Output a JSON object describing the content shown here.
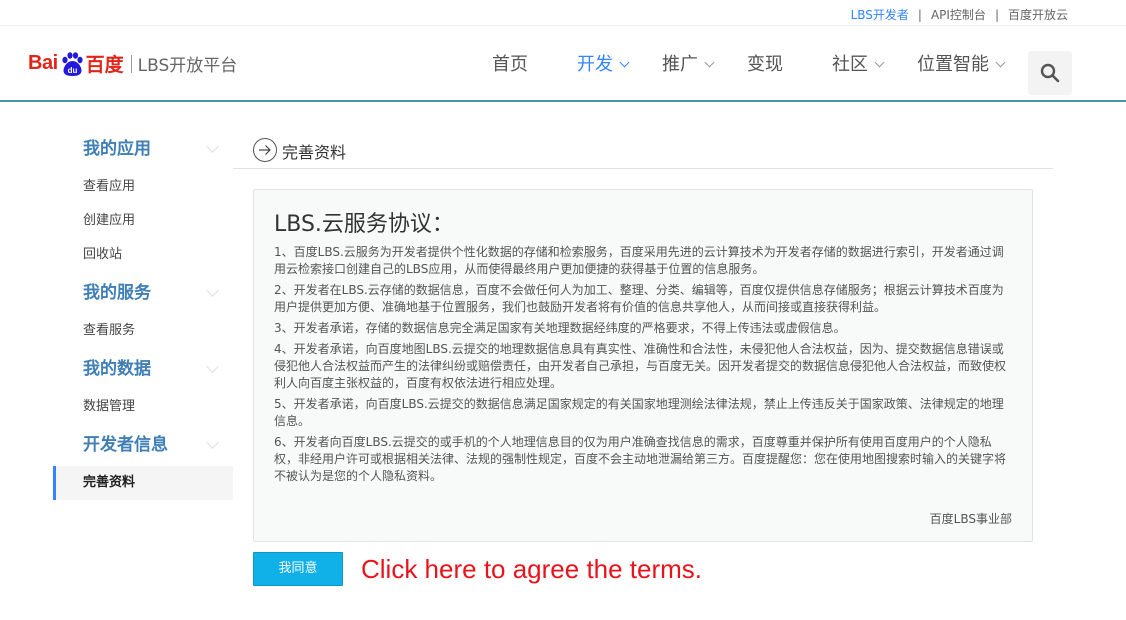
{
  "topbar": {
    "links": [
      "LBS开发者",
      "API控制台",
      "百度开放云"
    ],
    "separator": "|"
  },
  "header": {
    "logo_bai": "Bai",
    "logo_du": "du",
    "logo_cn": "百度",
    "platform": "LBS开放平台",
    "nav": [
      {
        "label": "首页"
      },
      {
        "label": "开发"
      },
      {
        "label": "推广"
      },
      {
        "label": "变现"
      },
      {
        "label": "社区"
      },
      {
        "label": "位置智能"
      }
    ]
  },
  "sidebar": {
    "groups": [
      {
        "title": "我的应用",
        "items": [
          "查看应用",
          "创建应用",
          "回收站"
        ]
      },
      {
        "title": "我的服务",
        "items": [
          "查看服务"
        ]
      },
      {
        "title": "我的数据",
        "items": [
          "数据管理"
        ]
      },
      {
        "title": "开发者信息",
        "items": [
          "完善资料"
        ]
      }
    ]
  },
  "main": {
    "section_title": "完善资料",
    "agreement": {
      "title": "LBS.云服务协议：",
      "paragraphs": [
        "1、百度LBS.云服务为开发者提供个性化数据的存储和检索服务，百度采用先进的云计算技术为开发者存储的数据进行索引，开发者通过调用云检索接口创建自己的LBS应用，从而使得最终用户更加便捷的获得基于位置的信息服务。",
        "2、开发者在LBS.云存储的数据信息，百度不会做任何人为加工、整理、分类、编辑等，百度仅提供信息存储服务；根据云计算技术百度为用户提供更加方便、准确地基于位置服务，我们也鼓励开发者将有价值的信息共享他人，从而间接或直接获得利益。",
        "3、开发者承诺，存储的数据信息完全满足国家有关地理数据经纬度的严格要求，不得上传违法或虚假信息。",
        "4、开发者承诺，向百度地图LBS.云提交的地理数据信息具有真实性、准确性和合法性，未侵犯他人合法权益，因为、提交数据信息错误或侵犯他人合法权益而产生的法律纠纷或赔偿责任，由开发者自己承担，与百度无关。因开发者提交的数据信息侵犯他人合法权益，而致使权利人向百度主张权益的，百度有权依法进行相应处理。",
        "5、开发者承诺，向百度LBS.云提交的数据信息满足国家规定的有关国家地理测绘法律法规，禁止上传违反关于国家政策、法律规定的地理信息。",
        "6、开发者向百度LBS.云提交的或手机的个人地理信息目的仅为用户准确查找信息的需求，百度尊重并保护所有使用百度用户的个人隐私权，非经用户许可或根据相关法律、法规的强制性规定，百度不会主动地泄漏给第三方。百度提醒您：您在使用地图搜索时输入的关键字将不被认为是您的个人隐私资料。"
      ],
      "signature": "百度LBS事业部"
    },
    "agree_button": "我同意",
    "hint": "Click here to agree the terms."
  },
  "colors": {
    "accent": "#3385ff",
    "brand_red": "#e1251b",
    "button": "#10b0e8",
    "hint": "#e8141c",
    "header_line": "#3f98a3"
  }
}
